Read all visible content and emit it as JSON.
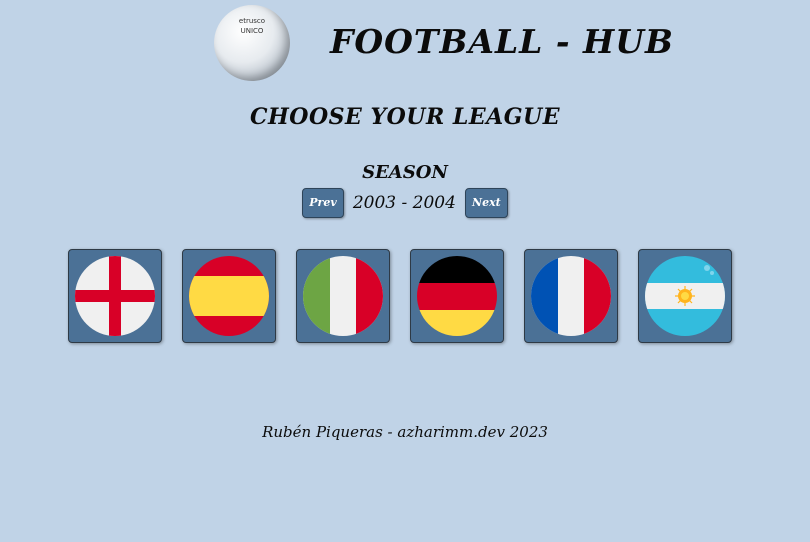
{
  "header": {
    "title": "FOOTBALL - HUB",
    "ball_brand": "etrusco",
    "ball_brand2": "UNICO"
  },
  "main": {
    "heading": "CHOOSE YOUR LEAGUE",
    "season": {
      "label": "SEASON",
      "prev_label": "Prev",
      "value": "2003 - 2004",
      "next_label": "Next"
    },
    "leagues": [
      {
        "flag": "england-flag-icon"
      },
      {
        "flag": "spain-flag-icon"
      },
      {
        "flag": "italy-flag-icon"
      },
      {
        "flag": "germany-flag-icon"
      },
      {
        "flag": "france-flag-icon"
      },
      {
        "flag": "argentina-flag-icon"
      }
    ]
  },
  "footer": {
    "credit": "Rubén Piqueras - azharimm.dev 2023"
  },
  "colors": {
    "background": "#c0d3e7",
    "button": "#4b7196"
  }
}
